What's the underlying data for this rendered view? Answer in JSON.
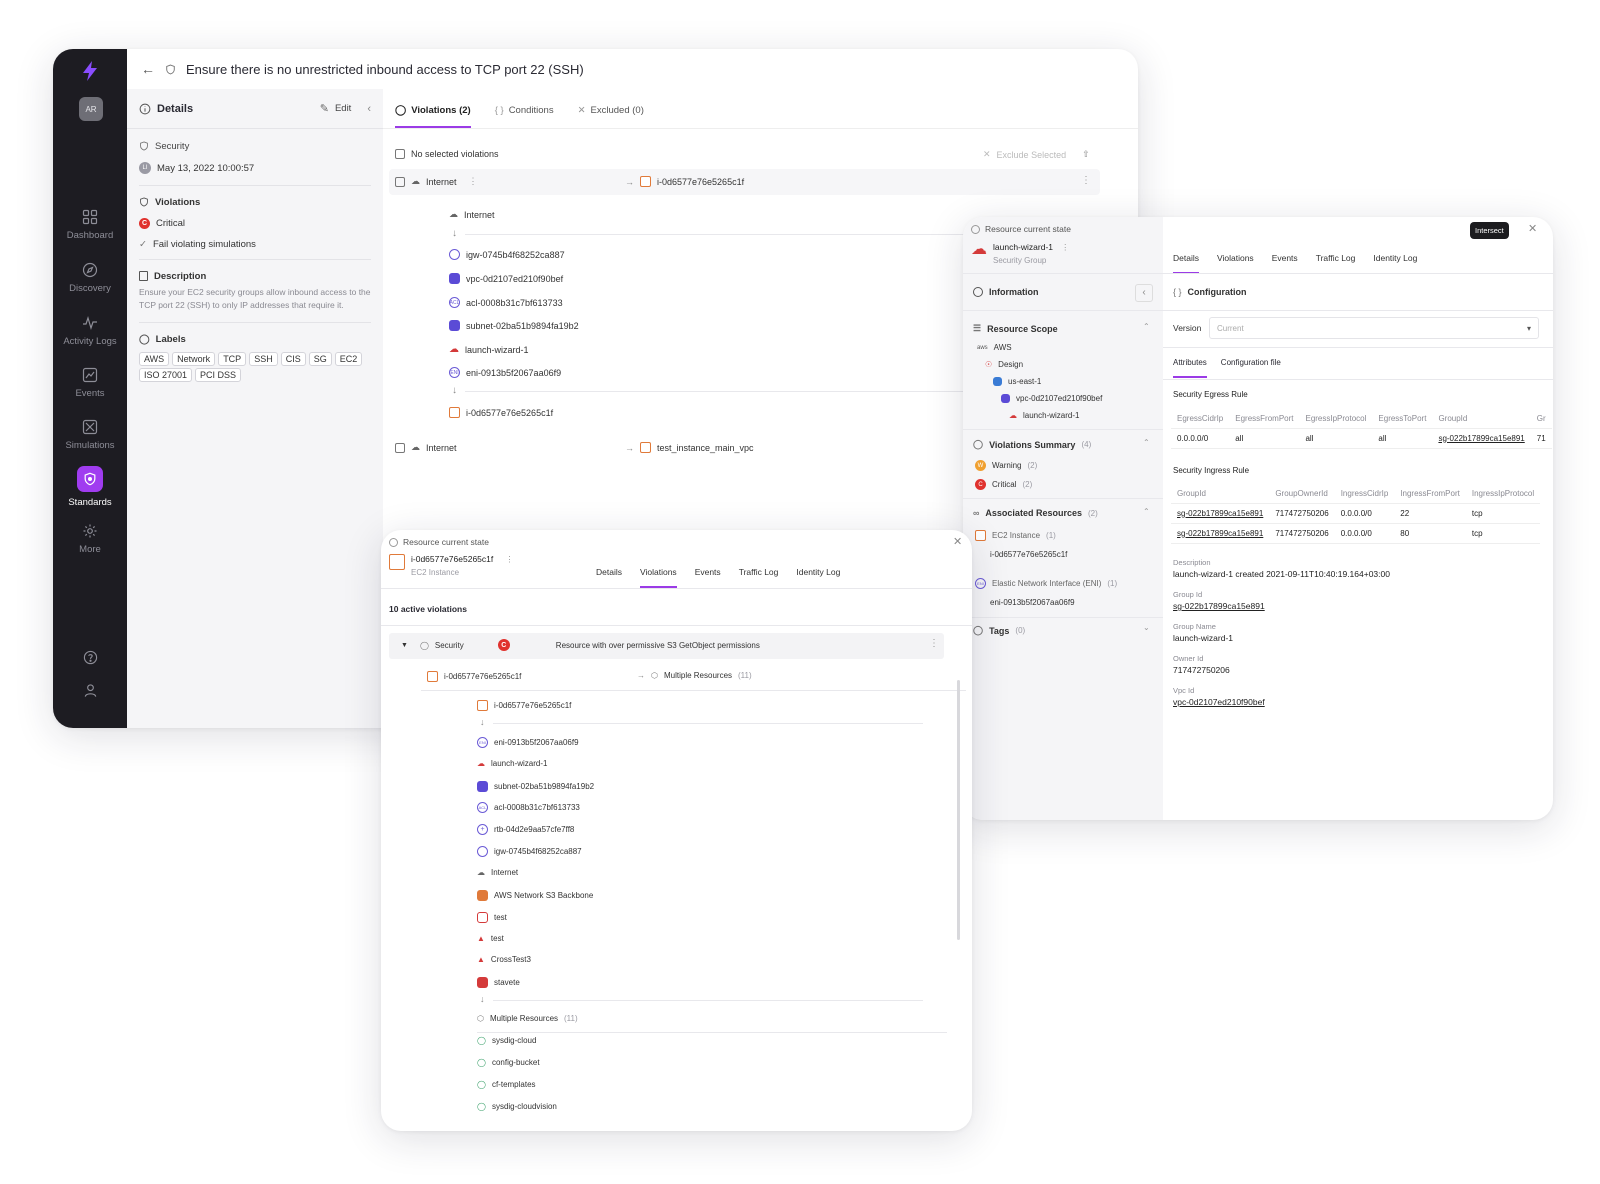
{
  "colors": {
    "accent": "#9b3be6",
    "sidebar_bg": "#1d1c22",
    "critical": "#e0322e",
    "warning": "#f0a030"
  },
  "sidebar": {
    "avatar": "AR",
    "items": [
      {
        "label": "Dashboard",
        "icon": "grid-icon"
      },
      {
        "label": "Discovery",
        "icon": "compass-icon"
      },
      {
        "label": "Activity Logs",
        "icon": "pulse-icon"
      },
      {
        "label": "Events",
        "icon": "chart-icon"
      },
      {
        "label": "Simulations",
        "icon": "atom-icon"
      },
      {
        "label": "Standards",
        "icon": "shield-icon",
        "active": true
      },
      {
        "label": "More",
        "icon": "gear-icon"
      }
    ]
  },
  "header": {
    "title": "Ensure there is no unrestricted inbound access to TCP port 22 (SSH)"
  },
  "details": {
    "title": "Details",
    "edit": "Edit",
    "category": "Security",
    "user_initials": "LI",
    "date": "May 13, 2022 10:00:57",
    "violations_title": "Violations",
    "severity": "Critical",
    "fail_sim": "Fail violating simulations",
    "description_title": "Description",
    "description": "Ensure your EC2 security groups allow inbound access to the TCP port 22 (SSH) to only IP addresses that require it.",
    "labels_title": "Labels",
    "labels": [
      "AWS",
      "Network",
      "TCP",
      "SSH",
      "CIS",
      "SG",
      "EC2",
      "ISO 27001",
      "PCI DSS"
    ]
  },
  "tabs": [
    {
      "label": "Violations (2)",
      "active": true
    },
    {
      "label": "Conditions"
    },
    {
      "label": "Excluded (0)"
    }
  ],
  "violations": {
    "select_label": "No selected violations",
    "exclude_label": "Exclude Selected",
    "row1_source": "Internet",
    "row1_target": "i-0d6577e76e5265c1f",
    "path": [
      "Internet",
      "igw-0745b4f68252ca887",
      "vpc-0d2107ed210f90bef",
      "acl-0008b31c7bf613733",
      "subnet-02ba51b9894fa19b2",
      "launch-wizard-1",
      "eni-0913b5f2067aa06f9",
      "i-0d6577e76e5265c1f"
    ],
    "row2_source": "Internet",
    "row2_target": "test_instance_main_vpc"
  },
  "res1": {
    "header": "Resource current state",
    "name": "i-0d6577e76e5265c1f",
    "type": "EC2 Instance",
    "tabs": [
      "Details",
      "Violations",
      "Events",
      "Traffic Log",
      "Identity Log"
    ],
    "active_count": "10 active violations",
    "group": "Security",
    "sev": "C",
    "violation": "Resource with over permissive S3 GetObject permissions",
    "from": "i-0d6577e76e5265c1f",
    "to": "Multiple Resources",
    "to_count": "(11)",
    "path": [
      "i-0d6577e76e5265c1f",
      "eni-0913b5f2067aa06f9",
      "launch-wizard-1",
      "subnet-02ba51b9894fa19b2",
      "acl-0008b31c7bf613733",
      "rtb-04d2e9aa57cfe7ff8",
      "igw-0745b4f68252ca887",
      "Internet",
      "AWS Network S3 Backbone",
      "test",
      "test",
      "CrossTest3",
      "stavete"
    ],
    "multi": "Multiple Resources",
    "multi_count": "(11)",
    "buckets": [
      "sysdig-cloud",
      "config-bucket",
      "cf-templates",
      "sysdig-cloudvision"
    ]
  },
  "res2": {
    "header": "Resource current state",
    "intersect": "Intersect",
    "name": "launch-wizard-1",
    "type": "Security Group",
    "tabs": [
      "Details",
      "Violations",
      "Events",
      "Traffic Log",
      "Identity Log"
    ],
    "info": "Information",
    "scope_title": "Resource Scope",
    "scope": [
      "AWS",
      "Design",
      "us-east-1",
      "vpc-0d2107ed210f90bef",
      "launch-wizard-1"
    ],
    "vs_title": "Violations Summary",
    "vs_count": "(4)",
    "warning": "Warning",
    "warning_count": "(2)",
    "critical": "Critical",
    "critical_count": "(2)",
    "assoc_title": "Associated Resources",
    "assoc_count": "(2)",
    "ec2_label": "EC2 Instance",
    "ec2_count": "(1)",
    "ec2_id": "i-0d6577e76e5265c1f",
    "eni_label": "Elastic Network Interface (ENI)",
    "eni_count": "(1)",
    "eni_id": "eni-0913b5f2067aa06f9",
    "tags_title": "Tags",
    "tags_count": "(0)",
    "config_title": "Configuration",
    "version_label": "Version",
    "version_value": "Current",
    "subtab_attr": "Attributes",
    "subtab_file": "Configuration file",
    "egress_title": "Security Egress Rule",
    "egress_headers": [
      "EgressCidrIp",
      "EgressFromPort",
      "EgressIpProtocol",
      "EgressToPort",
      "GroupId",
      "Gr"
    ],
    "egress_row": [
      "0.0.0.0/0",
      "all",
      "all",
      "all",
      "sg-022b17899ca15e891",
      "71"
    ],
    "ingress_title": "Security Ingress Rule",
    "ingress_headers": [
      "GroupId",
      "GroupOwnerId",
      "IngressCidrIp",
      "IngressFromPort",
      "IngressIpProtocol"
    ],
    "ingress_rows": [
      [
        "sg-022b17899ca15e891",
        "717472750206",
        "0.0.0.0/0",
        "22",
        "tcp"
      ],
      [
        "sg-022b17899ca15e891",
        "717472750206",
        "0.0.0.0/0",
        "80",
        "tcp"
      ]
    ],
    "desc_k": "Description",
    "desc_v": "launch-wizard-1 created 2021-09-11T10:40:19.164+03:00",
    "gid_k": "Group Id",
    "gid_v": "sg-022b17899ca15e891",
    "gname_k": "Group Name",
    "gname_v": "launch-wizard-1",
    "owner_k": "Owner Id",
    "owner_v": "717472750206",
    "vpc_k": "Vpc Id",
    "vpc_v": "vpc-0d2107ed210f90bef"
  }
}
